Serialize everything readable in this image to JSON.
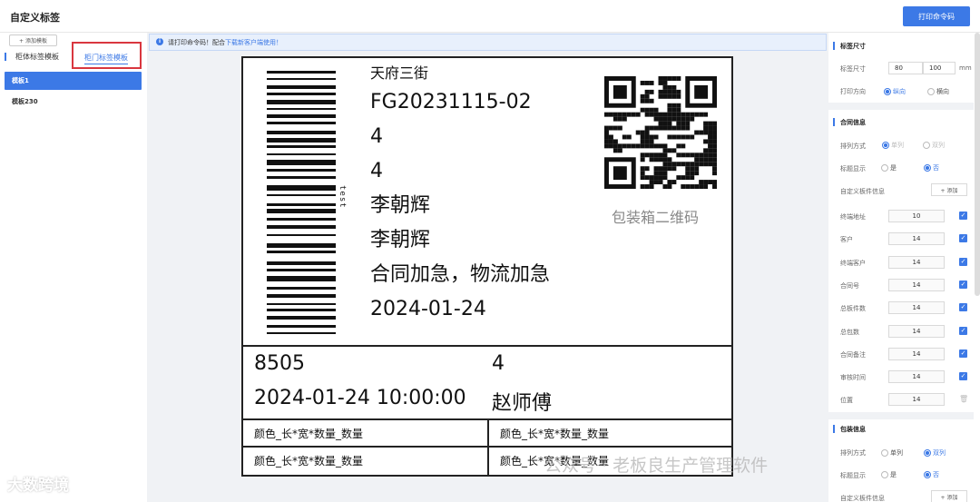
{
  "header": {
    "title": "自定义标签",
    "print_btn": "打印命令码"
  },
  "sidebar": {
    "add_btn": "+ 添加模板",
    "tab_a": "柜体标签模板",
    "tab_b": "柜门标签模板",
    "templates": [
      {
        "label": "模板1",
        "active": true
      },
      {
        "label": "模板230",
        "active": false
      }
    ]
  },
  "notice": {
    "text": "请打印命令码！配合",
    "link": "下载新客户端使用！"
  },
  "label_preview": {
    "vertical_text": "test",
    "lines": [
      "天府三街",
      "FG20231115-02",
      "4",
      "4",
      "李朝辉",
      "李朝辉",
      "合同加急，物流加急",
      "2024-01-24"
    ],
    "qr_caption": "包装箱二维码",
    "row2": {
      "a": "8505",
      "b": "4",
      "c": "2024-01-24 10:00:00",
      "d": "赵师傅"
    },
    "cells": [
      "颜色_长*宽*数量_数量",
      "颜色_长*宽*数量_数量",
      "颜色_长*宽*数量_数量",
      "颜色_长*宽*数量_数量"
    ]
  },
  "panel": {
    "size_section": "标签尺寸",
    "size_label": "标签尺寸",
    "width": "80",
    "height": "100",
    "unit": "mm",
    "direction_label": "打印方向",
    "dir_portrait": "纵向",
    "dir_landscape": "横向",
    "contract_section": "合同信息",
    "arrange_label": "排列方式",
    "arr_single": "单列",
    "arr_double": "双列",
    "title_label": "标题显示",
    "yes": "是",
    "no": "否",
    "custom_label": "自定义板件信息",
    "add_small": "+ 添加",
    "fields": [
      {
        "name": "终端地址",
        "value": "10",
        "mark": "check"
      },
      {
        "name": "客户",
        "value": "14",
        "mark": "check"
      },
      {
        "name": "终端客户",
        "value": "14",
        "mark": "check"
      },
      {
        "name": "合同号",
        "value": "14",
        "mark": "check"
      },
      {
        "name": "总板件数",
        "value": "14",
        "mark": "check"
      },
      {
        "name": "总包数",
        "value": "14",
        "mark": "check"
      },
      {
        "name": "合同备注",
        "value": "14",
        "mark": "check"
      },
      {
        "name": "审核时间",
        "value": "14",
        "mark": "check"
      },
      {
        "name": "位置",
        "value": "14",
        "mark": "trash"
      }
    ],
    "pack_section": "包装信息",
    "pack_arrange_label": "排列方式",
    "pack_arr_single": "单列",
    "pack_arr_double": "双列",
    "pack_title_label": "标题显示",
    "pack_yes": "是",
    "pack_no": "否",
    "pack_custom_label": "自定义板件信息",
    "pack_add_small": "+ 添加"
  },
  "watermarks": {
    "left": "大数跨境",
    "right": "公众号 · 老板良生产管理软件"
  }
}
